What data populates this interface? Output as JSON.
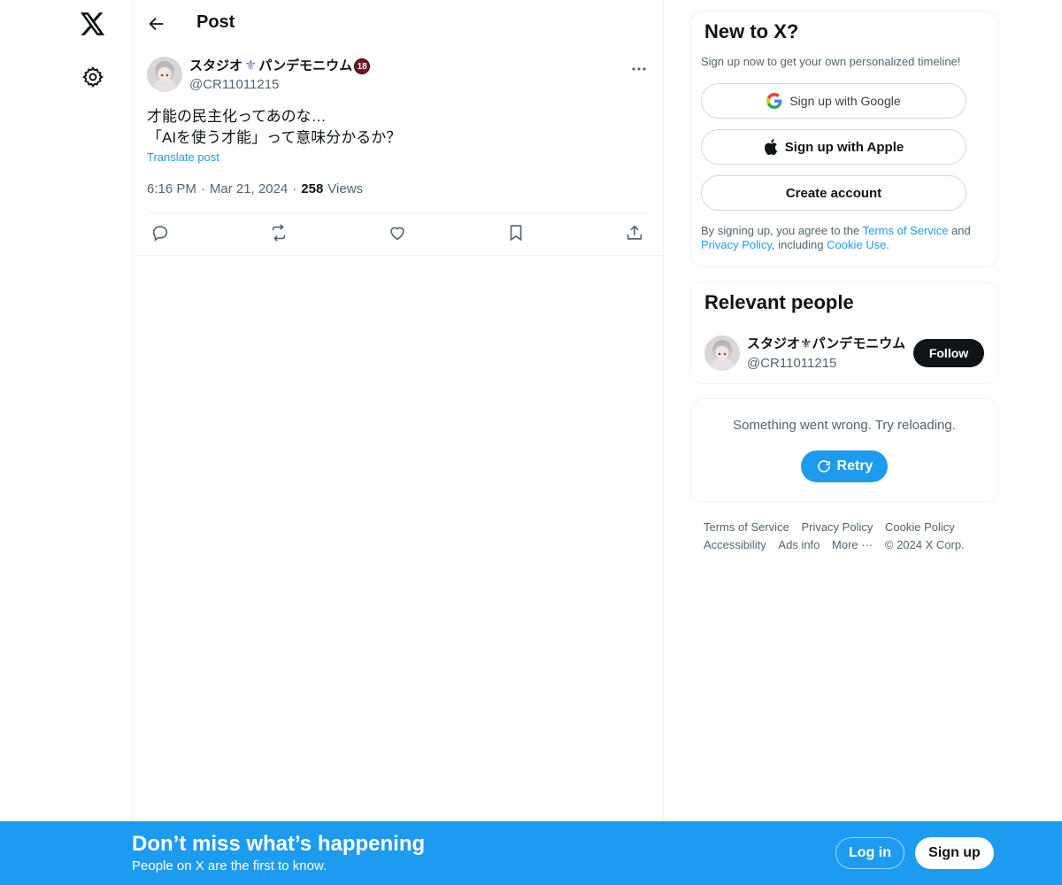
{
  "nav": {
    "logo_icon": "x-logo-icon",
    "settings_icon": "gear-icon"
  },
  "header": {
    "back_icon": "arrow-left-icon",
    "title": "Post"
  },
  "post": {
    "author_name": "スタジオ",
    "author_name_2": "パンデモニウム",
    "author_handle": "@CR11011215",
    "badge": "18",
    "text_line1": "才能の民主化ってあのな…",
    "text_line2": "「AIを使う才能」って意味分かるか？",
    "translate_label": "Translate post",
    "time": "6:16 PM",
    "date": "Mar 21, 2024",
    "views_count": "258",
    "views_label": "Views",
    "actions": [
      "reply-icon",
      "repost-icon",
      "like-icon",
      "bookmark-icon",
      "share-icon"
    ]
  },
  "signup_card": {
    "title": "New to X?",
    "subtitle": "Sign up now to get your own personalized timeline!",
    "google_label": "Sign up with Google",
    "apple_label": "Sign up with Apple",
    "create_label": "Create account",
    "legal_prefix": "By signing up, you agree to the",
    "terms_link": "Terms of Service",
    "and": "and",
    "privacy_link": "Privacy Policy",
    "including": ", including",
    "cookie_link": "Cookie Use."
  },
  "people_card": {
    "title": "Relevant people",
    "name": "スタジオ⚜パンデモニウム",
    "handle": "@CR11011215",
    "follow_label": "Follow"
  },
  "error_card": {
    "message": "Something went wrong. Try reloading.",
    "retry_label": "Retry"
  },
  "footer": {
    "links": [
      "Terms of Service",
      "Privacy Policy",
      "Cookie Policy",
      "Accessibility",
      "Ads info",
      "More ···",
      "© 2024 X Corp."
    ]
  },
  "bottom_bar": {
    "headline": "Don’t miss what’s happening",
    "subline": "People on X are the first to know.",
    "login_label": "Log in",
    "signup_label": "Sign up"
  },
  "colors": {
    "accent": "#1d9bf0",
    "text_primary": "#0f1419",
    "text_secondary": "#536471",
    "border": "#eff3f4"
  }
}
